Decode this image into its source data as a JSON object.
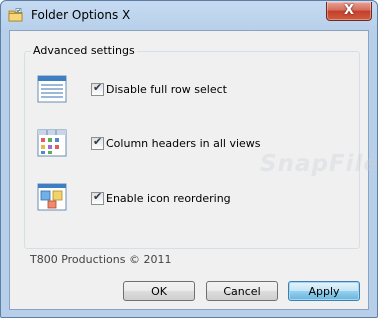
{
  "window": {
    "title": "Folder Options X",
    "close_label": "X"
  },
  "advanced": {
    "group_label": "Advanced settings",
    "options": [
      {
        "label": "Disable full row select",
        "checked": true,
        "icon": "list-view-icon"
      },
      {
        "label": "Column headers in all views",
        "checked": true,
        "icon": "grid-view-icon"
      },
      {
        "label": "Enable icon reordering",
        "checked": true,
        "icon": "icon-reorder-icon"
      }
    ]
  },
  "watermark": "SnapFiles",
  "footer": {
    "copyright": "T800 Productions © 2011"
  },
  "buttons": {
    "ok": "OK",
    "cancel": "Cancel",
    "apply": "Apply"
  },
  "colors": {
    "accent": "#3c7fb1",
    "titlebar": "#c6dbf2",
    "close": "#c4402c"
  }
}
